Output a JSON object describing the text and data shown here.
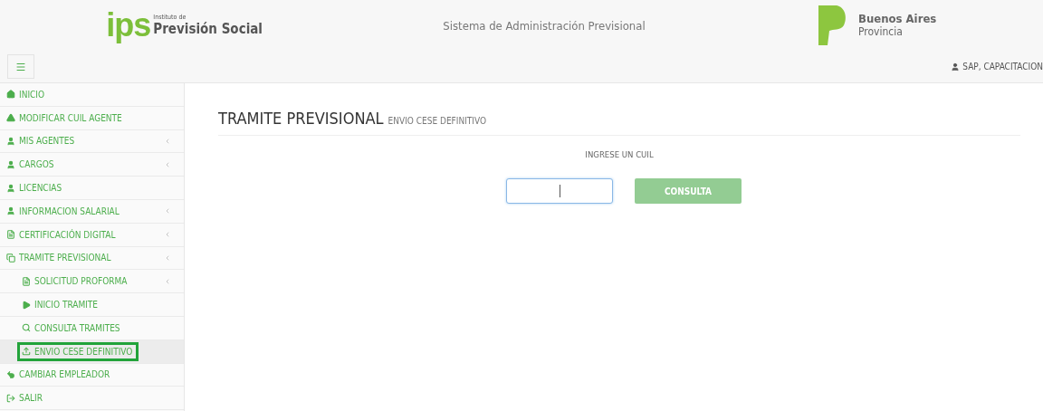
{
  "header": {
    "logo_mark": "ips",
    "logo_small": "Instituto de",
    "logo_big": "Previsión Social",
    "system_title": "Sistema de Administración Previsional",
    "province_name": "Buenos Aires",
    "province_sub": "Provincia",
    "user": "SAP, CAPACITACION"
  },
  "sidebar": {
    "items": [
      {
        "label": "INICIO",
        "has_submenu": false,
        "selected": false
      },
      {
        "label": "MODIFICAR CUIL AGENTE",
        "has_submenu": false,
        "selected": false
      },
      {
        "label": "MIS AGENTES",
        "has_submenu": true,
        "selected": false
      },
      {
        "label": "CARGOS",
        "has_submenu": true,
        "selected": false
      },
      {
        "label": "LICENCIAS",
        "has_submenu": false,
        "selected": false
      },
      {
        "label": "INFORMACION SALARIAL",
        "has_submenu": true,
        "selected": false
      },
      {
        "label": "CERTIFICACIÓN DIGITAL",
        "has_submenu": true,
        "selected": false
      },
      {
        "label": "TRAMITE PREVISIONAL",
        "has_submenu": true,
        "selected": false,
        "children": [
          {
            "label": "SOLICITUD PROFORMA",
            "has_submenu": true,
            "selected": false
          },
          {
            "label": "INICIO TRAMITE",
            "has_submenu": false,
            "selected": false
          },
          {
            "label": "CONSULTA TRAMITES",
            "has_submenu": false,
            "selected": false
          },
          {
            "label": "ENVIO CESE DEFINITIVO",
            "has_submenu": false,
            "selected": true
          }
        ]
      },
      {
        "label": "CAMBIAR EMPLEADOR",
        "has_submenu": false,
        "selected": false
      },
      {
        "label": "SALIR",
        "has_submenu": false,
        "selected": false
      }
    ]
  },
  "main": {
    "title": "TRAMITE PREVISIONAL",
    "subtitle": "ENVIO CESE DEFINITIVO",
    "field_label": "INGRESE UN CUIL",
    "cuil_field": {
      "focused": true
    },
    "button": {
      "label": "CONSULTA",
      "disabled": true
    }
  }
}
